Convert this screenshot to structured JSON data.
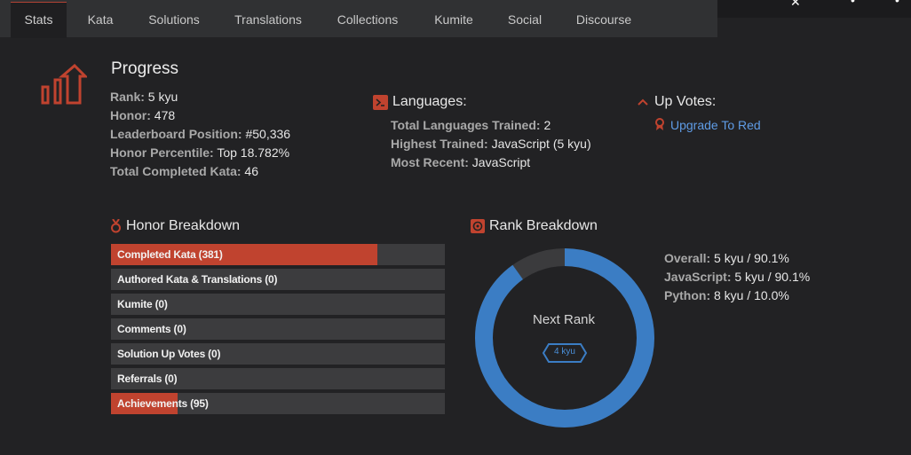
{
  "tabs": [
    {
      "label": "Stats",
      "active": true
    },
    {
      "label": "Kata"
    },
    {
      "label": "Solutions"
    },
    {
      "label": "Translations"
    },
    {
      "label": "Collections"
    },
    {
      "label": "Kumite"
    },
    {
      "label": "Social"
    },
    {
      "label": "Discourse"
    }
  ],
  "progress": {
    "title": "Progress",
    "rank_label": "Rank:",
    "rank": "5 kyu",
    "honor_label": "Honor:",
    "honor": "478",
    "leaderboard_label": "Leaderboard Position:",
    "leaderboard": "#50,336",
    "percentile_label": "Honor Percentile:",
    "percentile": "Top 18.782%",
    "completed_label": "Total Completed Kata:",
    "completed": "46"
  },
  "languages": {
    "title": "Languages:",
    "trained_label": "Total Languages Trained:",
    "trained": "2",
    "highest_label": "Highest Trained:",
    "highest": "JavaScript (5 kyu)",
    "recent_label": "Most Recent:",
    "recent": "JavaScript"
  },
  "upvotes": {
    "title": "Up Votes:",
    "link": "Upgrade To Red"
  },
  "honor_breakdown": {
    "title": "Honor Breakdown",
    "items": [
      {
        "label": "Completed Kata (381)",
        "fraction": 0.797
      },
      {
        "label": "Authored Kata & Translations (0)",
        "fraction": 0
      },
      {
        "label": "Kumite (0)",
        "fraction": 0
      },
      {
        "label": "Comments (0)",
        "fraction": 0
      },
      {
        "label": "Solution Up Votes (0)",
        "fraction": 0
      },
      {
        "label": "Referrals (0)",
        "fraction": 0
      },
      {
        "label": "Achievements (95)",
        "fraction": 0.199
      }
    ]
  },
  "rank_breakdown": {
    "title": "Rank Breakdown",
    "progress_fraction": 0.901,
    "next_rank_label": "Next Rank",
    "next_rank": "4 kyu",
    "overall_label": "Overall:",
    "overall": "5 kyu / 90.1%",
    "js_label": "JavaScript:",
    "js": "5 kyu / 90.1%",
    "py_label": "Python:",
    "py": "8 kyu / 10.0%"
  },
  "colors": {
    "accent": "#c0432f",
    "blue": "#3b7dc4",
    "link": "#5f9ce6"
  }
}
